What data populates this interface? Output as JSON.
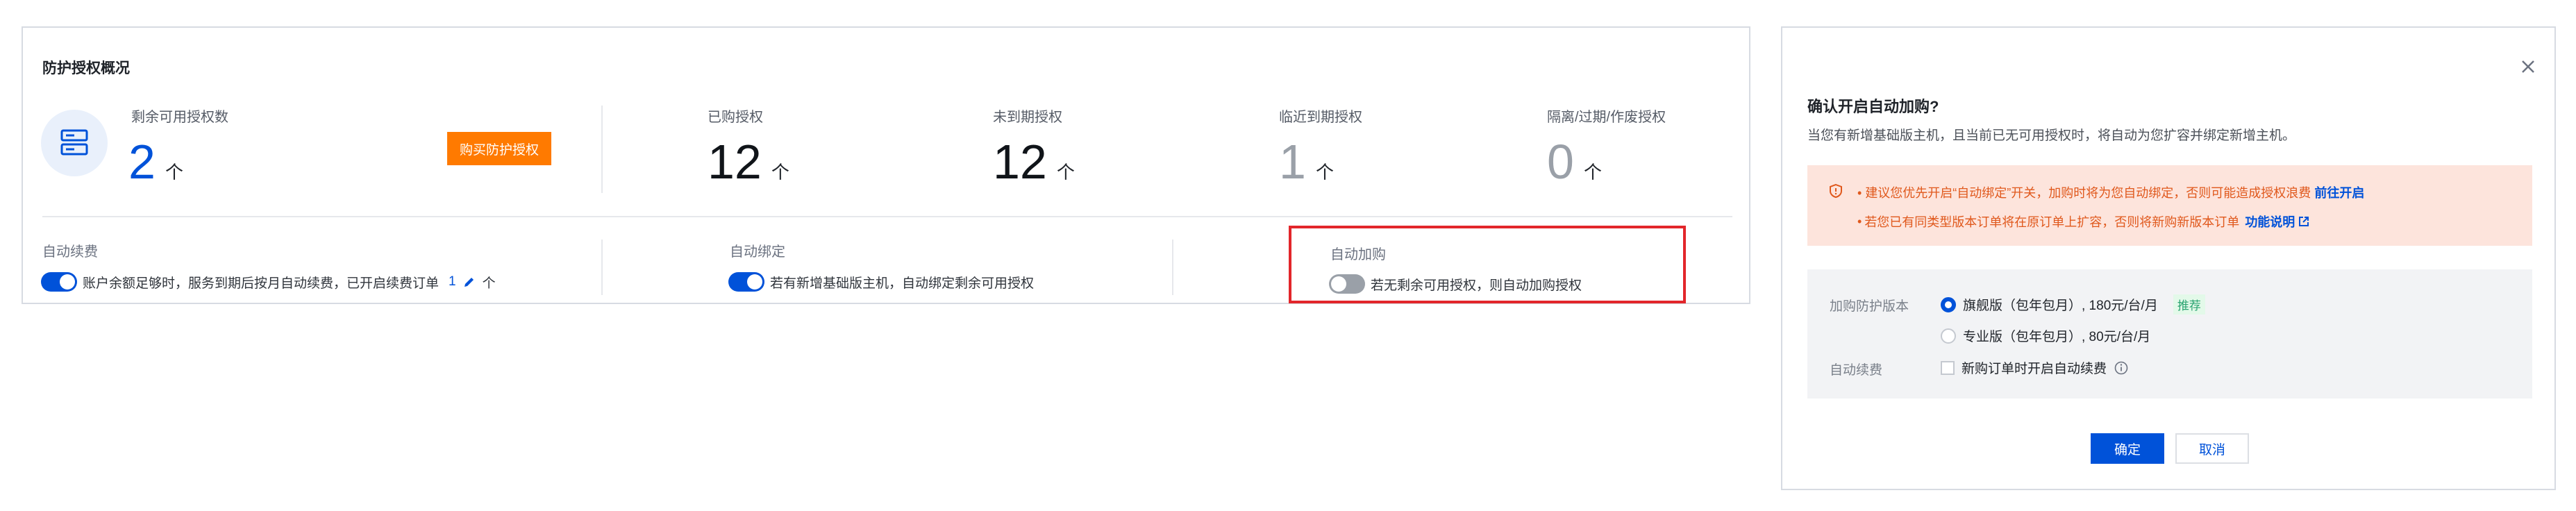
{
  "overview": {
    "title": "防护授权概况",
    "remaining": {
      "label": "剩余可用授权数",
      "value": "2",
      "unit": "个"
    },
    "buy_button": "购买防护授权",
    "stats": [
      {
        "label": "已购授权",
        "value": "12",
        "unit": "个"
      },
      {
        "label": "未到期授权",
        "value": "12",
        "unit": "个"
      },
      {
        "label": "临近到期授权",
        "value": "1",
        "unit": "个"
      },
      {
        "label": "隔离/过期/作废授权",
        "value": "0",
        "unit": "个"
      }
    ],
    "auto_renew": {
      "label": "自动续费",
      "enabled": true,
      "desc": "账户余额足够时，服务到期后按月自动续费，已开启续费订单",
      "count": "1",
      "unit": "个"
    },
    "auto_bind": {
      "label": "自动绑定",
      "enabled": true,
      "desc": "若有新增基础版主机，自动绑定剩余可用授权"
    },
    "auto_purchase": {
      "label": "自动加购",
      "enabled": false,
      "desc": "若无剩余可用授权，则自动加购授权"
    }
  },
  "dialog": {
    "title": "确认开启自动加购?",
    "subtitle": "当您有新增基础版主机，且当前已无可用授权时，将自动为您扩容并绑定新增主机。",
    "warnings": [
      {
        "text": "建议您优先开启“自动绑定”开关，加购时将为您自动绑定，否则可能造成授权浪费",
        "link": "前往开启"
      },
      {
        "text": "若您已有同类型版本订单将在原订单上扩容，否则将新购新版本订单",
        "link": "功能说明"
      }
    ],
    "version": {
      "label": "加购防护版本",
      "options": [
        {
          "text": "旗舰版（包年包月）, 180元/台/月",
          "selected": true,
          "tag": "推荐"
        },
        {
          "text": "专业版（包年包月）, 80元/台/月",
          "selected": false
        }
      ]
    },
    "renew": {
      "label": "自动续费",
      "checkbox_text": "新购订单时开启自动续费",
      "checked": false
    },
    "confirm_button": "确定",
    "cancel_button": "取消"
  },
  "icons": {
    "server": "server-icon",
    "edit": "edit-icon",
    "warning": "shield-warning-icon",
    "external": "external-link-icon",
    "info": "info-icon",
    "close": "close-icon"
  },
  "colors": {
    "primary": "#0052d9",
    "buy_button": "#ff7a00",
    "highlight": "#e2262b",
    "warning_bg": "#fde4dc",
    "warning_text": "#e0581c",
    "recommend": "#2ba471"
  }
}
